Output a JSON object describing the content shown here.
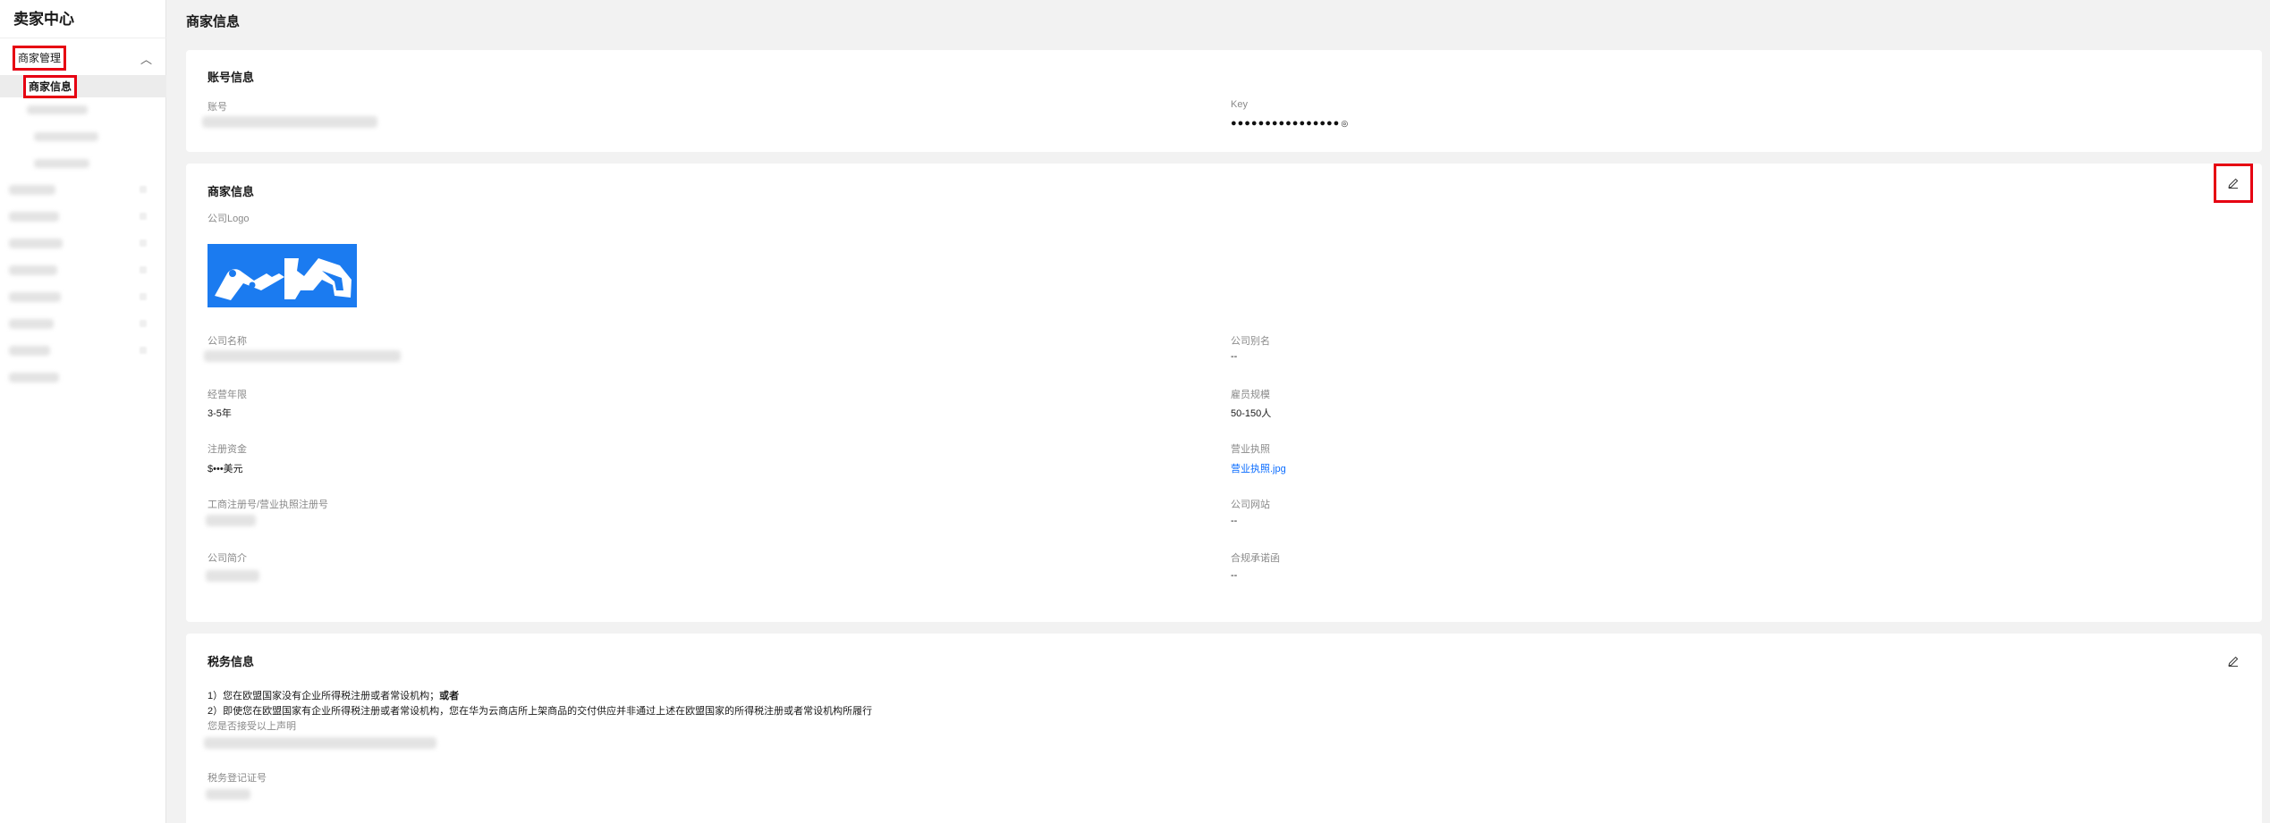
{
  "sidebar": {
    "title": "卖家中心",
    "group_label": "商家管理",
    "active_item": "商家信息"
  },
  "page_title": "商家信息",
  "account": {
    "title": "账号信息",
    "account_label": "账号",
    "key_label": "Key",
    "key_value": "●●●●●●●●●●●●●●●●"
  },
  "merchant": {
    "title": "商家信息",
    "logo_label": "公司Logo",
    "company_name_label": "公司名称",
    "company_alias_label": "公司别名",
    "company_alias_value": "--",
    "years_label": "经营年限",
    "years_value": "3-5年",
    "staff_label": "雇员规模",
    "staff_value": "50-150人",
    "capital_label": "注册资金",
    "capital_value": "$•••美元",
    "license_label": "营业执照",
    "license_value": "营业执照.jpg",
    "regno_label": "工商注册号/营业执照注册号",
    "website_label": "公司网站",
    "website_value": "--",
    "intro_label": "公司简介",
    "compliance_label": "合规承诺函",
    "compliance_value": "--"
  },
  "tax": {
    "title": "税务信息",
    "line1_prefix": "1）您在欧盟国家没有企业所得税注册或者常设机构；",
    "line1_bold": "或者",
    "line2": "2）即使您在欧盟国家有企业所得税注册或者常设机构，您在华为云商店所上架商品的交付供应并非通过上述在欧盟国家的所得税注册或者常设机构所履行",
    "accept_label": "您是否接受以上声明",
    "taxno_label": "税务登记证号"
  },
  "colors": {
    "accent_red": "#e60012",
    "link_blue": "#0a6cff",
    "logo_blue": "#1b7bf0",
    "page_bg": "#f2f2f2"
  },
  "icons": [
    "chevron-up-icon",
    "edit-pencil-icon",
    "eye-icon"
  ]
}
